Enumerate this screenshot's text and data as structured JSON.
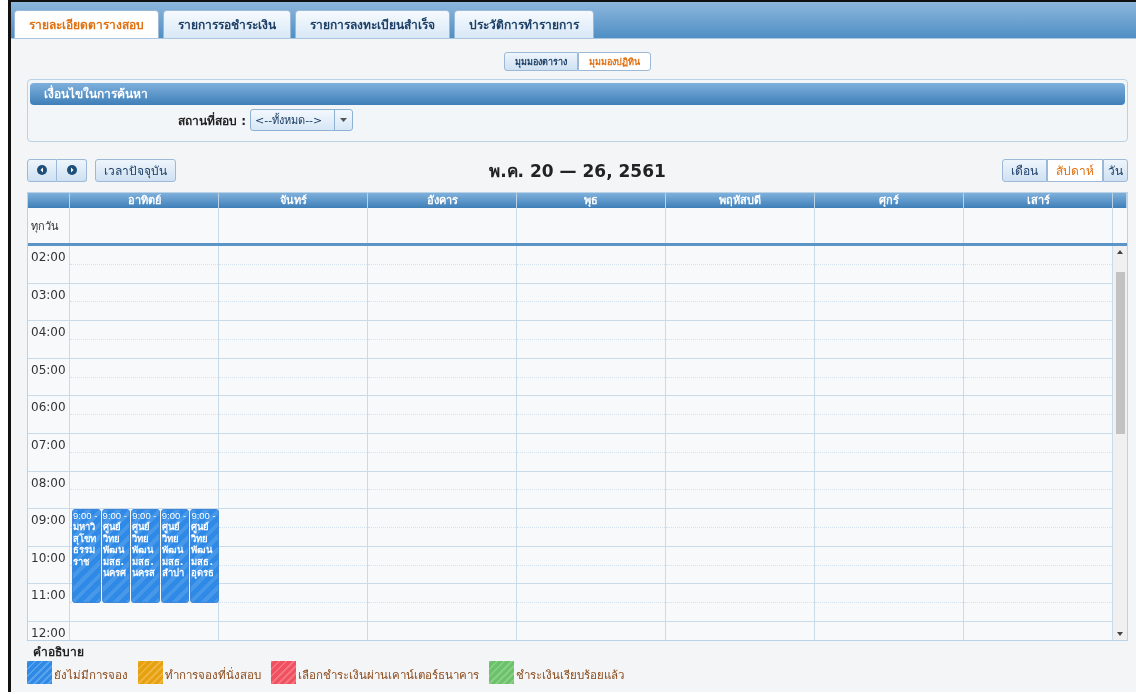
{
  "tabs": [
    {
      "label": "รายละเอียดตารางสอบ",
      "selected": true
    },
    {
      "label": "รายการรอชำระเงิน",
      "selected": false
    },
    {
      "label": "รายการลงทะเบียนสำเร็จ",
      "selected": false
    },
    {
      "label": "ประวัติการทำรายการ",
      "selected": false
    }
  ],
  "view_toggle": [
    {
      "label": "มุมมองตาราง",
      "selected": false
    },
    {
      "label": "มุมมองปฏิทิน",
      "selected": true
    }
  ],
  "search_panel": {
    "title": "เงื่อนไขในการค้นหา",
    "field_label": "สถานที่สอบ :",
    "select_value": "<--ทั้งหมด-->"
  },
  "toolbar": {
    "today_button": "เวลาปัจจุบัน",
    "title": "พ.ค. 20 — 26, 2561",
    "views": [
      {
        "label": "เดือน",
        "selected": false
      },
      {
        "label": "สัปดาห์",
        "selected": true
      },
      {
        "label": "วัน",
        "selected": false
      }
    ]
  },
  "calendar": {
    "all_day_label": "ทุกวัน",
    "hours": [
      "02:00",
      "03:00",
      "04:00",
      "05:00",
      "06:00",
      "07:00",
      "08:00",
      "09:00",
      "10:00",
      "11:00",
      "12:00"
    ],
    "days": [
      {
        "label": "อาทิตย์",
        "events": [
          {
            "time": "9:00 -",
            "color": "#2e8ae6",
            "lines": [
              "มหาวิ",
              "สุโขท",
              "ธรรม",
              "ราช"
            ]
          },
          {
            "time": "9:00 -",
            "color": "#2e8ae6",
            "lines": [
              "ศูนย์",
              "วิทย",
              "พัฒน",
              "มสธ.",
              "นครศ"
            ]
          },
          {
            "time": "9:00 -",
            "color": "#2e8ae6",
            "lines": [
              "ศูนย์",
              "วิทย",
              "พัฒน",
              "มสธ.",
              "นครส"
            ]
          },
          {
            "time": "9:00 -",
            "color": "#2e8ae6",
            "lines": [
              "ศูนย์",
              "วิทย",
              "พัฒน",
              "มสธ.",
              "ลำปา"
            ]
          },
          {
            "time": "9:00 -",
            "color": "#2e8ae6",
            "lines": [
              "ศูนย์",
              "วิทย",
              "พัฒน",
              "มสธ.",
              "อุดรธ"
            ]
          }
        ]
      },
      {
        "label": "จันทร์"
      },
      {
        "label": "อังคาร"
      },
      {
        "label": "พุธ"
      },
      {
        "label": "พฤหัสบดี"
      },
      {
        "label": "ศุกร์"
      },
      {
        "label": "เสาร์"
      }
    ]
  },
  "legend": {
    "title": "คำอธิบาย",
    "items": [
      {
        "label": "ยังไม่มีการจอง",
        "color": "#2e8ae6"
      },
      {
        "label": "ทำการจองที่นั่งสอบ",
        "color": "#e8a10e"
      },
      {
        "label": "เลือกชำระเงินผ่านเคาน์เตอร์ธนาคาร",
        "color": "#f0505f"
      },
      {
        "label": "ชำระเงินเรียบร้อยแล้ว",
        "color": "#6cc26a"
      }
    ]
  }
}
